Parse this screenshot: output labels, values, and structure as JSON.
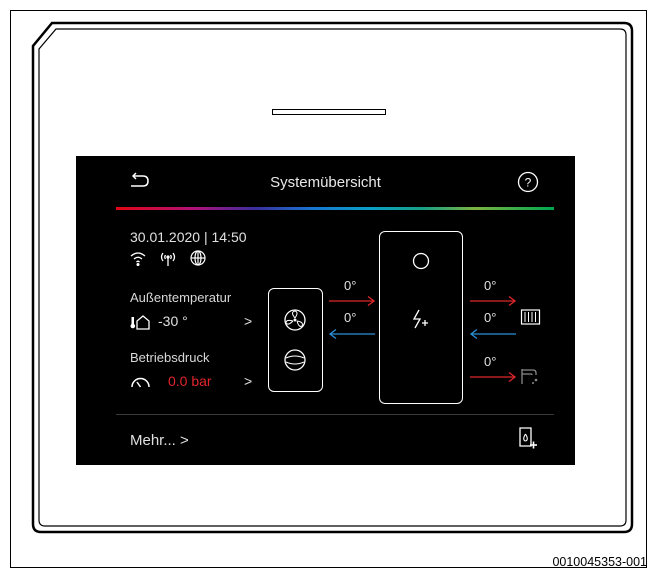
{
  "screen": {
    "title": "Systemübersicht",
    "datetime": "30.01.2020 | 14:50",
    "outdoor": {
      "label": "Außentemperatur",
      "value": "-30 °",
      "chevron": ">"
    },
    "pressure": {
      "label": "Betriebsdruck",
      "value": "0.0 bar",
      "chevron": ">"
    },
    "flows": {
      "left_supply": "0°",
      "left_return": "0°",
      "right_heating_supply": "0°",
      "right_heating_return": "0°",
      "right_dhw": "0°"
    },
    "more_link": "Mehr... >",
    "accent_colors": {
      "alert_red": "#e0262b",
      "supply_red": "#e0262b",
      "return_blue": "#2a8fd6"
    },
    "icons": [
      "back-arrow-icon",
      "help-icon",
      "wifi-icon",
      "antenna-icon",
      "globe-icon",
      "thermometer-house-icon",
      "gauge-icon",
      "fan-icon",
      "compressor-icon",
      "circle-icon",
      "electric-heater-icon",
      "radiator-icon",
      "tap-icon",
      "boiler-add-icon"
    ]
  },
  "figure_code": "0010045353-001"
}
